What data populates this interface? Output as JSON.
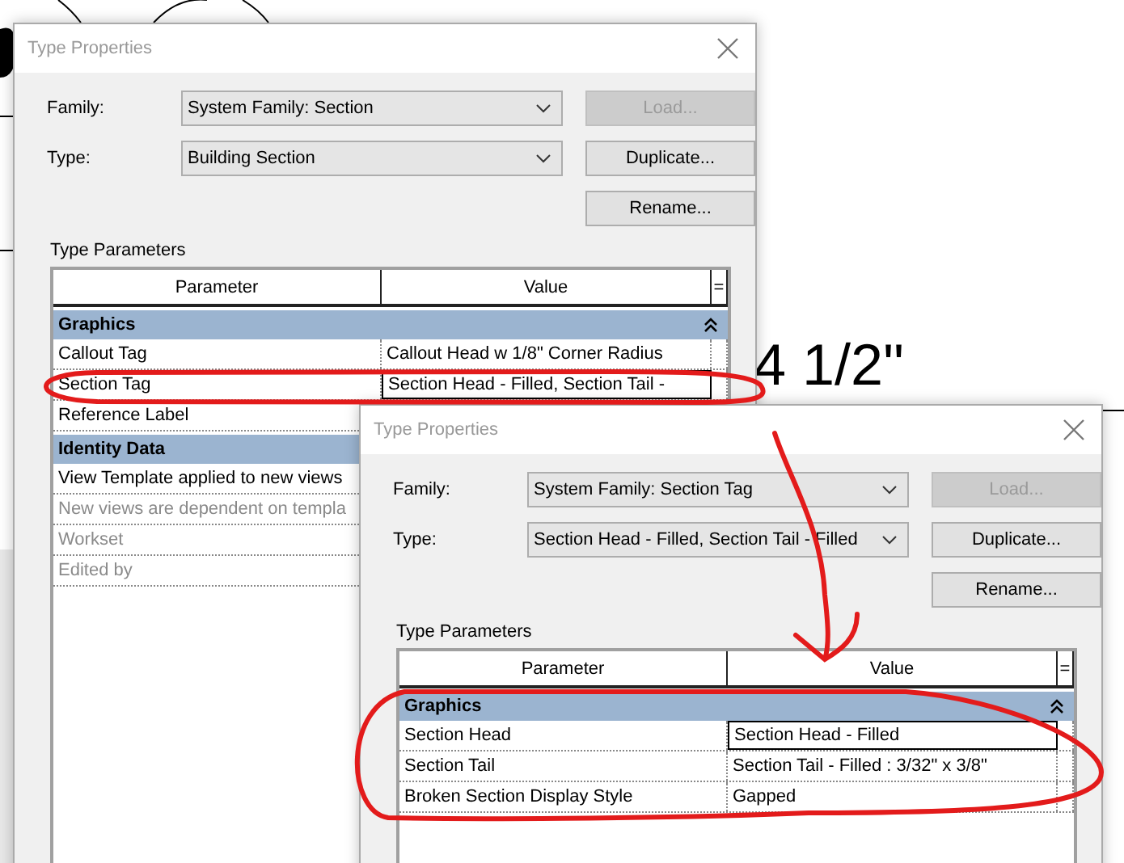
{
  "canvas": {
    "dimension_text": "4 1/2\""
  },
  "dialogs": [
    {
      "title": "Type Properties",
      "family": {
        "label": "Family:",
        "value": "System Family: Section"
      },
      "type": {
        "label": "Type:",
        "value": "Building Section"
      },
      "buttons": [
        {
          "label": "Load...",
          "disabled": true
        },
        {
          "label": "Duplicate...",
          "disabled": false
        },
        {
          "label": "Rename...",
          "disabled": false
        }
      ],
      "parameters_label": "Type Parameters",
      "columns": [
        "Parameter",
        "Value",
        "="
      ],
      "groups": [
        {
          "name": "Graphics",
          "expanded": true,
          "rows": [
            {
              "parameter": "Callout Tag",
              "value": "Callout Head w 1/8\" Corner Radius",
              "dimmed": false,
              "selected": false
            },
            {
              "parameter": "Section Tag",
              "value": "Section Head - Filled, Section Tail -",
              "dimmed": false,
              "selected": true
            },
            {
              "parameter": "Reference Label",
              "dimmed": false
            }
          ]
        },
        {
          "name": "Identity Data",
          "rows": [
            {
              "parameter": "View Template applied to new views",
              "dimmed": false
            },
            {
              "parameter": "New views are dependent on templa",
              "dimmed": true
            },
            {
              "parameter": "Workset",
              "dimmed": true
            },
            {
              "parameter": "Edited by",
              "dimmed": true
            }
          ]
        }
      ]
    },
    {
      "title": "Type Properties",
      "family": {
        "label": "Family:",
        "value": "System Family: Section Tag"
      },
      "type": {
        "label": "Type:",
        "value": "Section Head - Filled, Section Tail - Filled"
      },
      "buttons": [
        {
          "label": "Load...",
          "disabled": true
        },
        {
          "label": "Duplicate...",
          "disabled": false
        },
        {
          "label": "Rename...",
          "disabled": false
        }
      ],
      "parameters_label": "Type Parameters",
      "columns": [
        "Parameter",
        "Value",
        "="
      ],
      "groups": [
        {
          "name": "Graphics",
          "expanded": true,
          "rows": [
            {
              "parameter": "Section Head",
              "value": "Section Head - Filled",
              "dimmed": false,
              "selected": true
            },
            {
              "parameter": "Section Tail",
              "value": "Section Tail - Filled : 3/32\" x 3/8\"",
              "dimmed": false,
              "selected": false
            },
            {
              "parameter": "Broken Section Display Style",
              "value": "Gapped",
              "dimmed": false,
              "selected": false
            }
          ]
        }
      ]
    }
  ]
}
